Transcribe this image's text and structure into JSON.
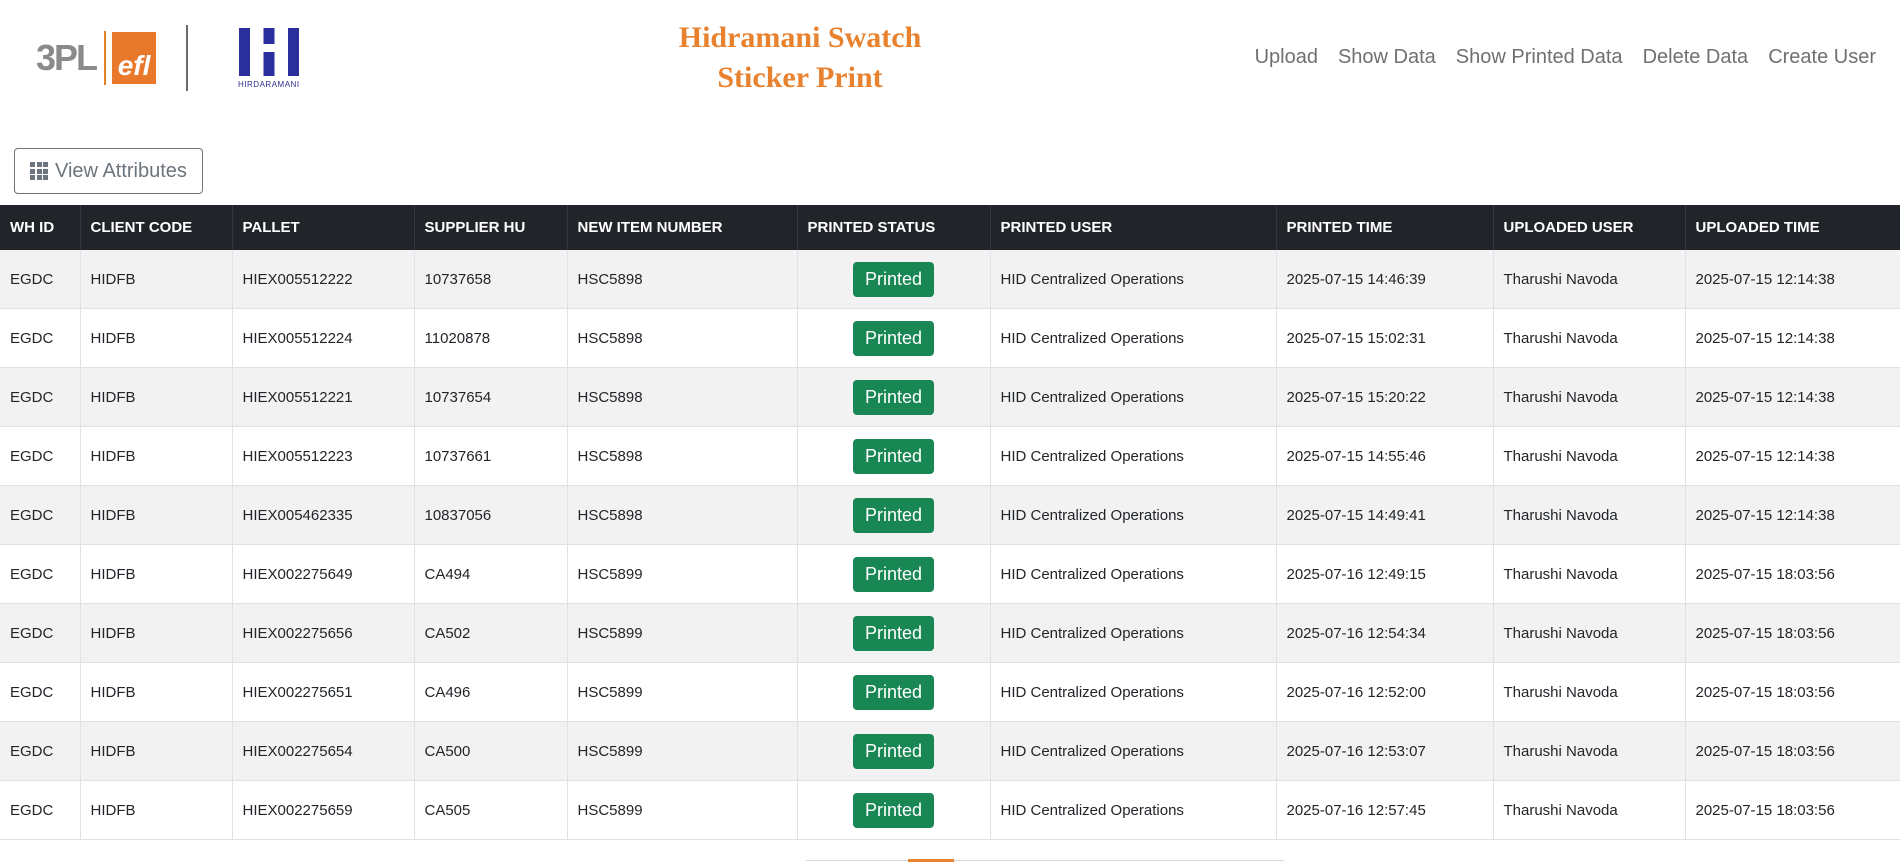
{
  "header": {
    "logo_3pl_text": "3PL",
    "logo_efl_text": "efl",
    "logo_h_text": "HIRDARAMANI",
    "title_line1": "Hidramani Swatch",
    "title_line2": "Sticker Print",
    "accent_color": "#e8822f"
  },
  "nav": {
    "items": [
      {
        "label": "Upload"
      },
      {
        "label": "Show Data"
      },
      {
        "label": "Show Printed Data"
      },
      {
        "label": "Delete Data"
      },
      {
        "label": "Create User"
      }
    ]
  },
  "toolbar": {
    "view_attributes_label": "View Attributes",
    "icon": "grid-icon"
  },
  "table": {
    "columns": [
      "WH ID",
      "CLIENT CODE",
      "PALLET",
      "SUPPLIER HU",
      "NEW ITEM NUMBER",
      "PRINTED STATUS",
      "PRINTED USER",
      "PRINTED TIME",
      "UPLOADED USER",
      "UPLOADED TIME"
    ],
    "status_color": "#198754",
    "rows": [
      {
        "wh_id": "EGDC",
        "client_code": "HIDFB",
        "pallet": "HIEX005512222",
        "supplier_hu": "10737658",
        "new_item_number": "HSC5898",
        "printed_status": "Printed",
        "printed_user": "HID Centralized Operations",
        "printed_time": "2025-07-15 14:46:39",
        "uploaded_user": "Tharushi Navoda",
        "uploaded_time": "2025-07-15 12:14:38"
      },
      {
        "wh_id": "EGDC",
        "client_code": "HIDFB",
        "pallet": "HIEX005512224",
        "supplier_hu": "11020878",
        "new_item_number": "HSC5898",
        "printed_status": "Printed",
        "printed_user": "HID Centralized Operations",
        "printed_time": "2025-07-15 15:02:31",
        "uploaded_user": "Tharushi Navoda",
        "uploaded_time": "2025-07-15 12:14:38"
      },
      {
        "wh_id": "EGDC",
        "client_code": "HIDFB",
        "pallet": "HIEX005512221",
        "supplier_hu": "10737654",
        "new_item_number": "HSC5898",
        "printed_status": "Printed",
        "printed_user": "HID Centralized Operations",
        "printed_time": "2025-07-15 15:20:22",
        "uploaded_user": "Tharushi Navoda",
        "uploaded_time": "2025-07-15 12:14:38"
      },
      {
        "wh_id": "EGDC",
        "client_code": "HIDFB",
        "pallet": "HIEX005512223",
        "supplier_hu": "10737661",
        "new_item_number": "HSC5898",
        "printed_status": "Printed",
        "printed_user": "HID Centralized Operations",
        "printed_time": "2025-07-15 14:55:46",
        "uploaded_user": "Tharushi Navoda",
        "uploaded_time": "2025-07-15 12:14:38"
      },
      {
        "wh_id": "EGDC",
        "client_code": "HIDFB",
        "pallet": "HIEX005462335",
        "supplier_hu": "10837056",
        "new_item_number": "HSC5898",
        "printed_status": "Printed",
        "printed_user": "HID Centralized Operations",
        "printed_time": "2025-07-15 14:49:41",
        "uploaded_user": "Tharushi Navoda",
        "uploaded_time": "2025-07-15 12:14:38"
      },
      {
        "wh_id": "EGDC",
        "client_code": "HIDFB",
        "pallet": "HIEX002275649",
        "supplier_hu": "CA494",
        "new_item_number": "HSC5899",
        "printed_status": "Printed",
        "printed_user": "HID Centralized Operations",
        "printed_time": "2025-07-16 12:49:15",
        "uploaded_user": "Tharushi Navoda",
        "uploaded_time": "2025-07-15 18:03:56"
      },
      {
        "wh_id": "EGDC",
        "client_code": "HIDFB",
        "pallet": "HIEX002275656",
        "supplier_hu": "CA502",
        "new_item_number": "HSC5899",
        "printed_status": "Printed",
        "printed_user": "HID Centralized Operations",
        "printed_time": "2025-07-16 12:54:34",
        "uploaded_user": "Tharushi Navoda",
        "uploaded_time": "2025-07-15 18:03:56"
      },
      {
        "wh_id": "EGDC",
        "client_code": "HIDFB",
        "pallet": "HIEX002275651",
        "supplier_hu": "CA496",
        "new_item_number": "HSC5899",
        "printed_status": "Printed",
        "printed_user": "HID Centralized Operations",
        "printed_time": "2025-07-16 12:52:00",
        "uploaded_user": "Tharushi Navoda",
        "uploaded_time": "2025-07-15 18:03:56"
      },
      {
        "wh_id": "EGDC",
        "client_code": "HIDFB",
        "pallet": "HIEX002275654",
        "supplier_hu": "CA500",
        "new_item_number": "HSC5899",
        "printed_status": "Printed",
        "printed_user": "HID Centralized Operations",
        "printed_time": "2025-07-16 12:53:07",
        "uploaded_user": "Tharushi Navoda",
        "uploaded_time": "2025-07-15 18:03:56"
      },
      {
        "wh_id": "EGDC",
        "client_code": "HIDFB",
        "pallet": "HIEX002275659",
        "supplier_hu": "CA505",
        "new_item_number": "HSC5899",
        "printed_status": "Printed",
        "printed_user": "HID Centralized Operations",
        "printed_time": "2025-07-16 12:57:45",
        "uploaded_user": "Tharushi Navoda",
        "uploaded_time": "2025-07-15 18:03:56"
      }
    ]
  }
}
